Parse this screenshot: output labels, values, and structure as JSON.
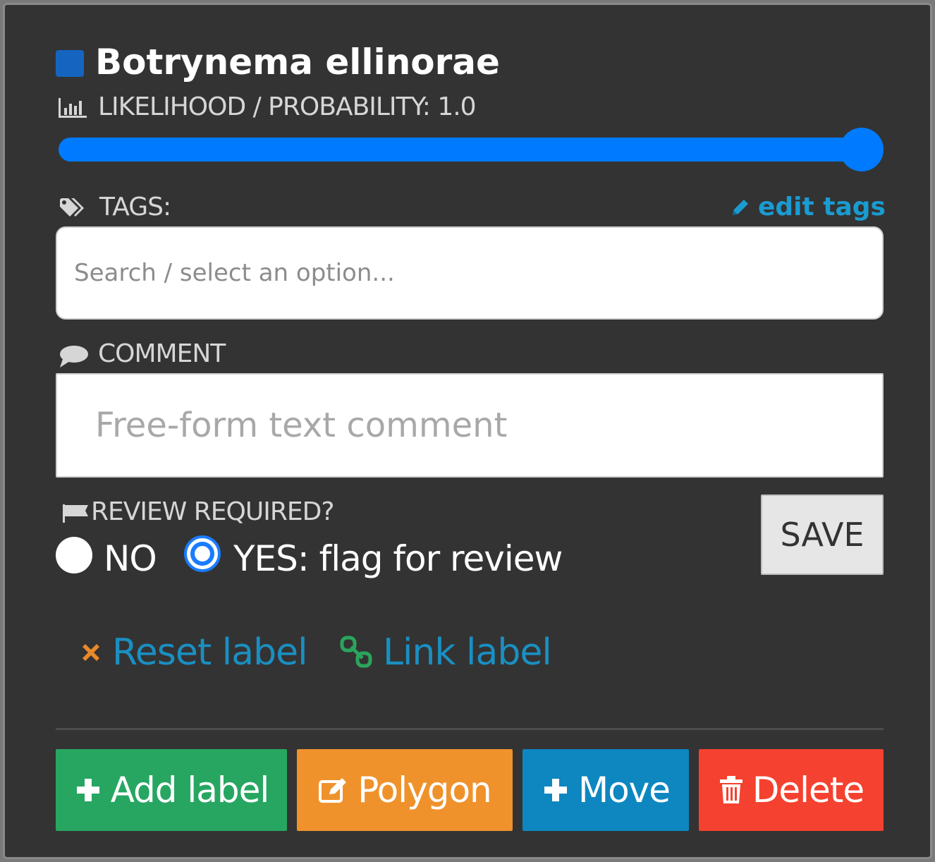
{
  "label": {
    "name": "Botrynema ellinorae",
    "swatch_color": "#1565c0"
  },
  "likelihood": {
    "label": "LIKELIHOOD / PROBABILITY: 1.0",
    "value": 1.0,
    "icon": "bar-chart-icon"
  },
  "tags": {
    "label": "TAGS:",
    "icon": "tags-icon",
    "edit_label": "edit tags",
    "edit_icon": "pencil-icon",
    "placeholder": "Search / select an option..."
  },
  "comment": {
    "label": "COMMENT",
    "icon": "speech-bubble-icon",
    "placeholder": "Free-form text comment"
  },
  "review": {
    "label": "REVIEW REQUIRED?",
    "icon": "flag-icon",
    "options": [
      {
        "label": "NO",
        "selected": false
      },
      {
        "label": "YES: flag for review",
        "selected": true
      }
    ],
    "save_label": "SAVE"
  },
  "links": {
    "reset": {
      "label": "Reset label",
      "icon": "x-icon",
      "icon_color": "#e8892a"
    },
    "link": {
      "label": "Link label",
      "icon": "link-icon",
      "icon_color": "#2aa55c"
    }
  },
  "buttons": [
    {
      "label": "Add label",
      "icon": "plus-icon",
      "color": "#27a662"
    },
    {
      "label": "Polygon",
      "icon": "edit-icon",
      "color": "#ef922c"
    },
    {
      "label": "Move",
      "icon": "plus-icon",
      "color": "#0e87c0"
    },
    {
      "label": "Delete",
      "icon": "trash-icon",
      "color": "#f5412f"
    }
  ]
}
